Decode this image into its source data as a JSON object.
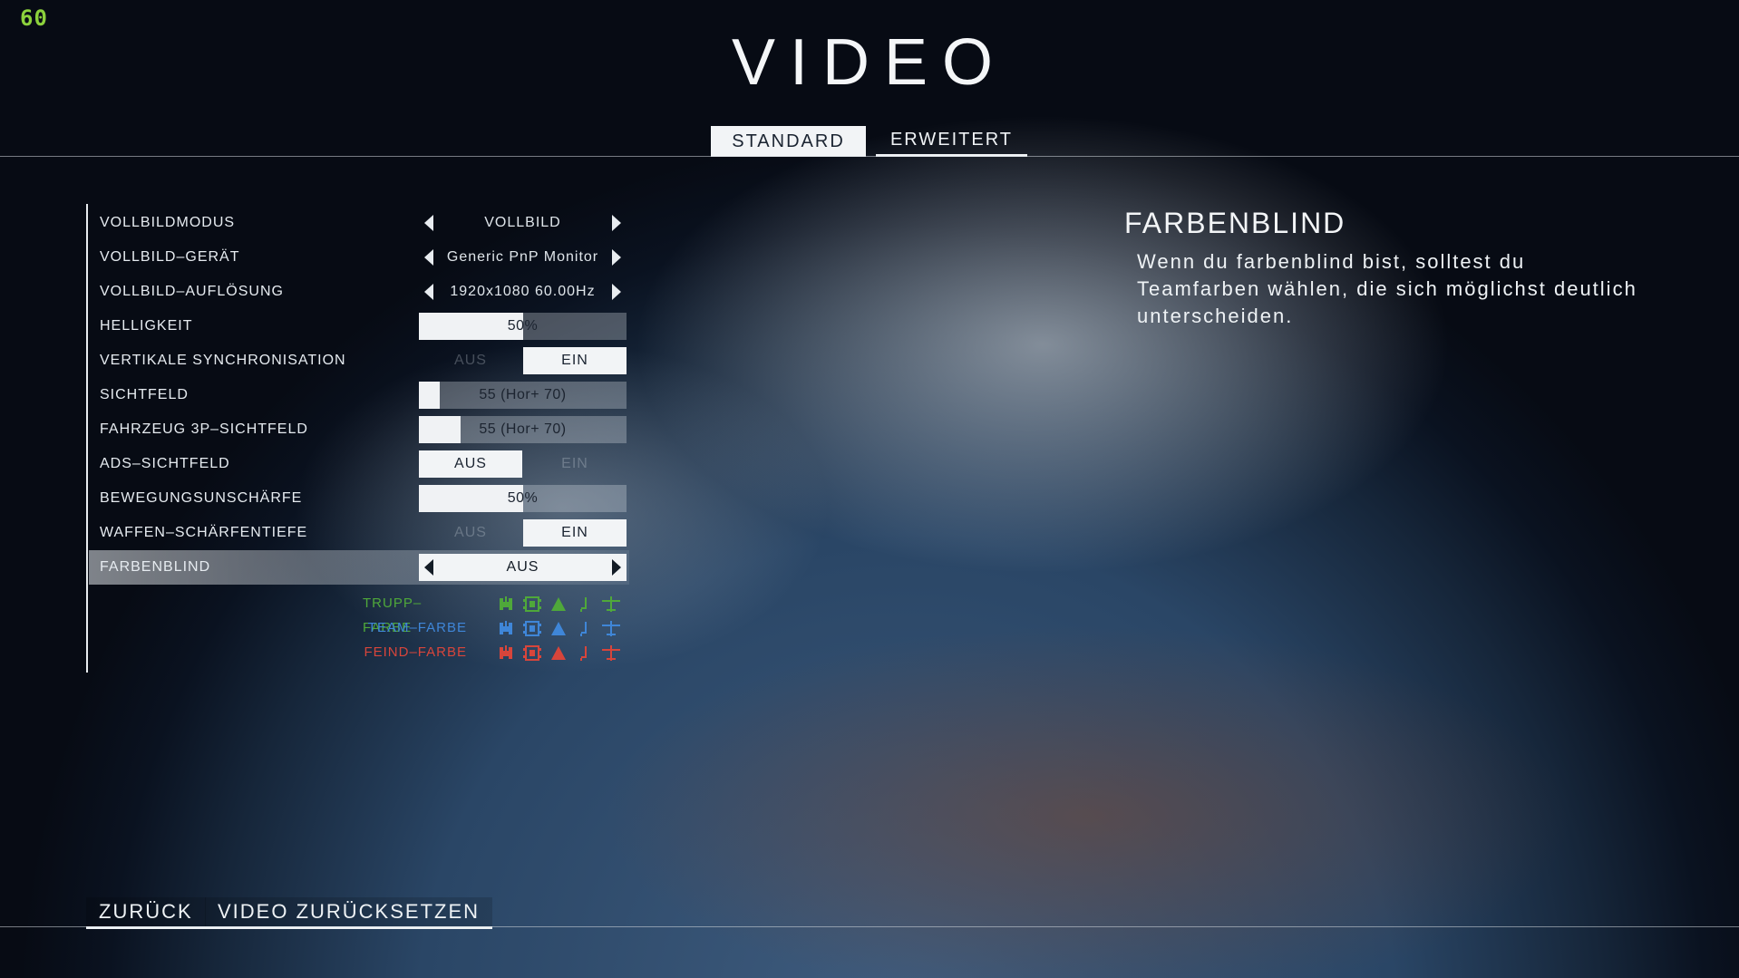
{
  "fps_counter": "60",
  "page_title": "VIDEO",
  "tabs": [
    {
      "label": "STANDARD",
      "active": true
    },
    {
      "label": "ERWEITERT",
      "active": false
    }
  ],
  "settings": {
    "fullscreen_mode": {
      "label": "VOLLBILDMODUS",
      "value": "VOLLBILD"
    },
    "fullscreen_device": {
      "label": "VOLLBILD–GERÄT",
      "value": "Generic PnP Monitor"
    },
    "fullscreen_resolution": {
      "label": "VOLLBILD–AUFLÖSUNG",
      "value": "1920x1080 60.00Hz"
    },
    "brightness": {
      "label": "HELLIGKEIT",
      "value": "50%",
      "level": 0.5
    },
    "vsync": {
      "label": "VERTIKALE SYNCHRONISATION",
      "off": "AUS",
      "on": "EIN",
      "selected": "EIN"
    },
    "fov": {
      "label": "SICHTFELD",
      "value": "55 (Hor+ 70)",
      "level": 0.1
    },
    "vehicle_fov": {
      "label": "FAHRZEUG 3P–SICHTFELD",
      "value": "55 (Hor+ 70)",
      "level": 0.2
    },
    "ads_fov": {
      "label": "ADS–SICHTFELD",
      "off": "AUS",
      "on": "EIN",
      "selected": "AUS"
    },
    "motion_blur": {
      "label": "BEWEGUNGSUNSCHÄRFE",
      "value": "50%",
      "level": 0.5
    },
    "weapon_dof": {
      "label": "WAFFEN–SCHÄRFENTIEFE",
      "off": "AUS",
      "on": "EIN",
      "selected": "EIN"
    },
    "colorblind": {
      "label": "FARBENBLIND",
      "value": "AUS"
    }
  },
  "color_legend": [
    {
      "label": "TRUPP–FARBE",
      "color": "#4fa83a"
    },
    {
      "label": "TEAM–FARBE",
      "color": "#3f86d8"
    },
    {
      "label": "FEIND–FARBE",
      "color": "#d7453b"
    }
  ],
  "help": {
    "title": "FARBENBLIND",
    "text": "Wenn du farbenblind bist, solltest du Teamfarben wählen, die sich möglichst deutlich unterscheiden."
  },
  "footer": {
    "back_label": "ZURÜCK",
    "reset_label": "VIDEO ZURÜCKSETZEN"
  }
}
